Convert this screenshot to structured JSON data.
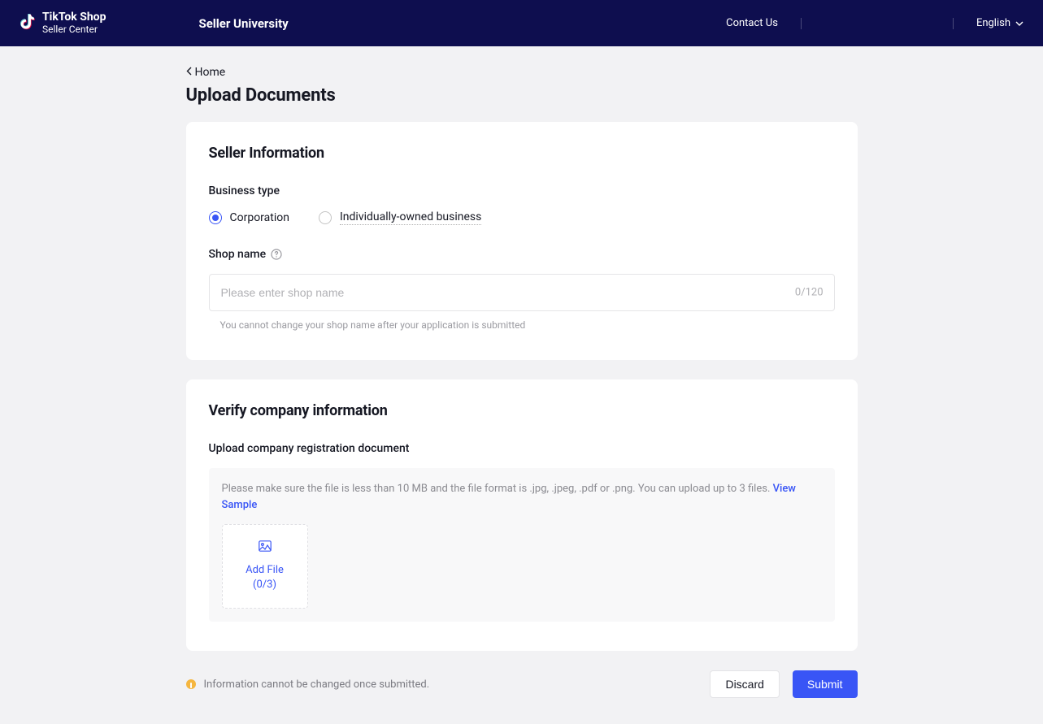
{
  "header": {
    "logo_line1": "TikTok Shop",
    "logo_line2": "Seller Center",
    "title": "Seller University",
    "contact": "Contact Us",
    "language": "English"
  },
  "nav": {
    "back_label": "Home"
  },
  "page": {
    "title": "Upload Documents"
  },
  "seller_info": {
    "title": "Seller Information",
    "business_type_label": "Business type",
    "options": {
      "corporation": "Corporation",
      "individual": "Individually-owned business"
    },
    "selected": "corporation",
    "shop_name_label": "Shop name",
    "shop_name_placeholder": "Please enter shop name",
    "shop_name_value": "",
    "char_count": "0/120",
    "shop_name_helper": "You cannot change your shop name after your application is submitted"
  },
  "verify": {
    "title": "Verify company information",
    "upload_label": "Upload company registration document",
    "note_text": "Please make sure the file is less than 10 MB and the file format is .jpg, .jpeg, .pdf or .png. You can upload up to 3 files. ",
    "view_sample": "View Sample",
    "add_file_label": "Add File",
    "add_file_count": "(0/3)"
  },
  "footer": {
    "warning": "Information cannot be changed once submitted.",
    "discard": "Discard",
    "submit": "Submit"
  }
}
